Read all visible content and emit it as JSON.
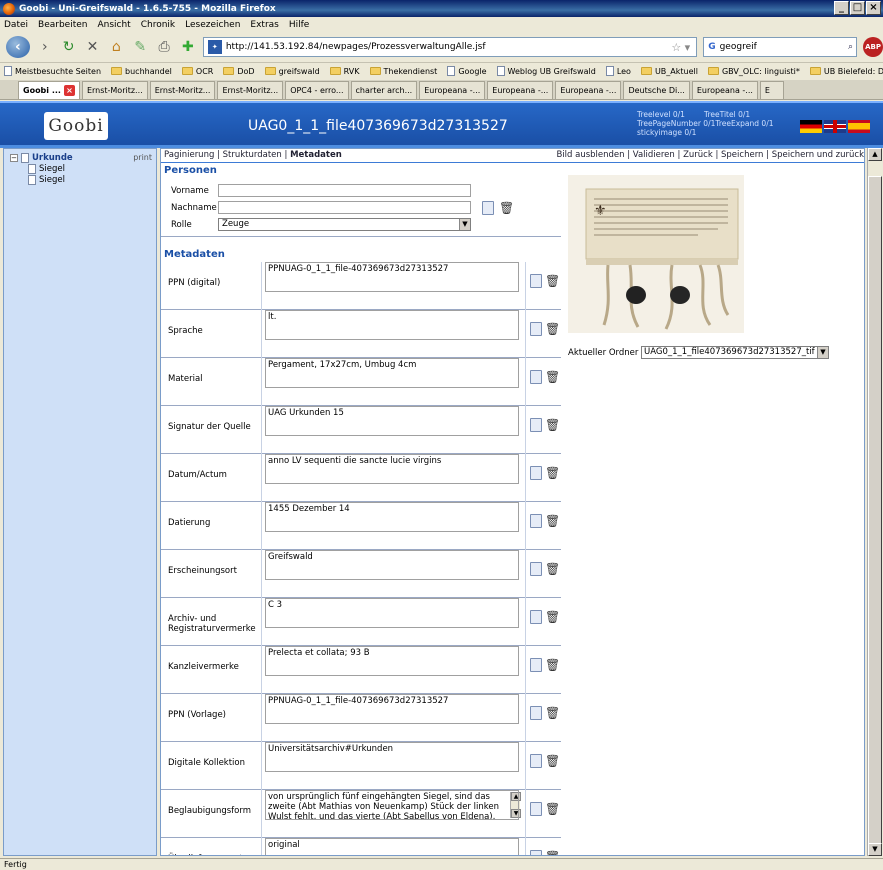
{
  "window": {
    "title": "Goobi - Uni-Greifswald - 1.6.5-755 - Mozilla Firefox"
  },
  "menu": [
    "Datei",
    "Bearbeiten",
    "Ansicht",
    "Chronik",
    "Lesezeichen",
    "Extras",
    "Hilfe"
  ],
  "nav": {
    "url": "http://141.53.192.84/newpages/ProzessverwaltungAlle.jsf",
    "search_value": "geogreif",
    "search_engine": "G",
    "abp": "ABP"
  },
  "bookmarks": [
    "Meistbesuchte Seiten",
    "buchhandel",
    "OCR",
    "DoD",
    "greifswald",
    "RVK",
    "Thekendienst",
    "Google",
    "Weblog UB Greifswald",
    "Leo",
    "UB_Aktuell",
    "GBV_OLC: linguisti*",
    "UB Bielefeld: Digitale ..."
  ],
  "tabs": [
    "Goobi ...",
    "Ernst-Moritz...",
    "Ernst-Moritz...",
    "Ernst-Moritz...",
    "OPC4 - erro...",
    "charter arch...",
    "Europeana -...",
    "Europeana -...",
    "Europeana -...",
    "Deutsche Di...",
    "Europeana -...",
    "E"
  ],
  "header": {
    "logo": "Goobi",
    "title": "UAG0_1_1_file407369673d27313527",
    "info_line1": "Treelevel 0/1        TreeTitel 0/1",
    "info_line2": "TreePageNumber 0/1TreeExpand 0/1",
    "info_line3": "stickyimage 0/1"
  },
  "tree": {
    "root": "Urkunde",
    "print": "print",
    "children": [
      "Siegel",
      "Siegel"
    ]
  },
  "toolbar": {
    "pagination": "Paginierung",
    "structure": "Strukturdaten",
    "metadata": "Metadaten",
    "right": "Bild ausblenden | Validieren | Zurück | Speichern | Speichern und zurück"
  },
  "persons": {
    "heading": "Personen",
    "firstname_label": "Vorname",
    "lastname_label": "Nachname",
    "role_label": "Rolle",
    "role_value": "Zeuge"
  },
  "metadata": {
    "heading": "Metadaten",
    "rows": [
      {
        "label": "PPN (digital)",
        "value": "PPNUAG-0_1_1_file-407369673d27313527"
      },
      {
        "label": "Sprache",
        "value": "lt."
      },
      {
        "label": "Material",
        "value": "Pergament, 17x27cm, Umbug 4cm"
      },
      {
        "label": "Signatur der Quelle",
        "value": "UAG Urkunden 15"
      },
      {
        "label": "Datum/Actum",
        "value": "anno LV sequenti die sancte lucie virgins"
      },
      {
        "label": "Datierung",
        "value": "1455 Dezember 14"
      },
      {
        "label": "Erscheinungsort",
        "value": "Greifswald"
      },
      {
        "label": "Archiv- und Registraturvermerke",
        "value": "C 3"
      },
      {
        "label": "Kanzleivermerke",
        "value": "Prelecta et collata; 93 B"
      },
      {
        "label": "PPN (Vorlage)",
        "value": "PPNUAG-0_1_1_file-407369673d27313527"
      },
      {
        "label": "Digitale Kollektion",
        "value": "Universitätsarchiv#Urkunden"
      },
      {
        "label": "Beglaubigungsform",
        "value": "von ursprünglich fünf eingehängten Siegel, sind das zweite (Abt Mathias von Neuenkamp) Stück der linken Wulst fehlt, und das vierte (Abt Sabellus von Eldena), Wulst fehlt, gut"
      },
      {
        "label": "Überlieferungsart",
        "value": "original"
      }
    ]
  },
  "image_panel": {
    "folder_label": "Aktueller Ordner",
    "folder_value": "UAG0_1_1_file407369673d27313527_tif"
  },
  "status": "Fertig"
}
